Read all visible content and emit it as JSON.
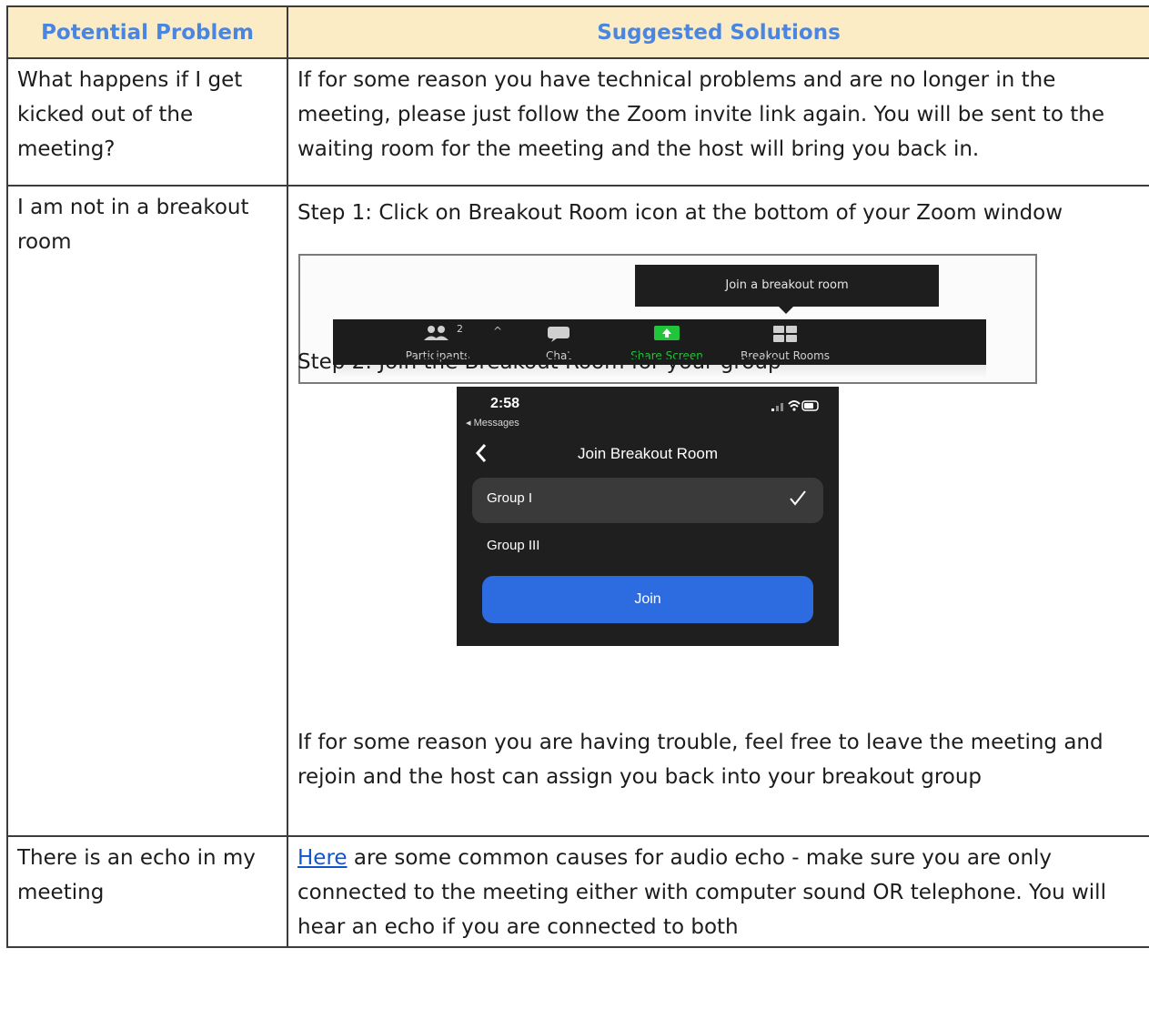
{
  "table": {
    "header": {
      "col1": "Potential Problem",
      "col2": "Suggested Solutions"
    },
    "rows": [
      {
        "problem": "What happens if I get kicked out of the meeting?",
        "solution": "If for some reason you have technical problems and are no longer in the meeting, please just follow the Zoom invite link again. You will be sent to the waiting room for the meeting and the host will bring you back in."
      },
      {
        "problem": "I am not in a breakout room",
        "step1": "Step 1: Click on Breakout Room icon at the bottom of your Zoom window",
        "step2": "Step 2: Join the Breakout Room for your group",
        "trouble": "If for some reason you are having trouble, feel free to leave the meeting and rejoin and the host can assign you back into your breakout group"
      },
      {
        "problem": "There is an echo in my meeting",
        "link_text": "Here",
        "solution_rest": " are some common causes for audio echo - make sure you are only connected to the meeting either with computer sound OR telephone. You will hear an echo if you are connected to both"
      }
    ]
  },
  "zoom_toolbar": {
    "tooltip": "Join a breakout room",
    "participants_label": "Participants",
    "participants_count": "2",
    "chat_label": "Chat",
    "share_label": "Share Screen",
    "breakout_label": "Breakout Rooms",
    "share_color": "#21c53a"
  },
  "phone": {
    "time": "2:58",
    "back_label": "◂ Messages",
    "title": "Join Breakout Room",
    "groups": [
      "Group I",
      "Group III"
    ],
    "join_label": "Join",
    "accent": "#2d6be0"
  }
}
